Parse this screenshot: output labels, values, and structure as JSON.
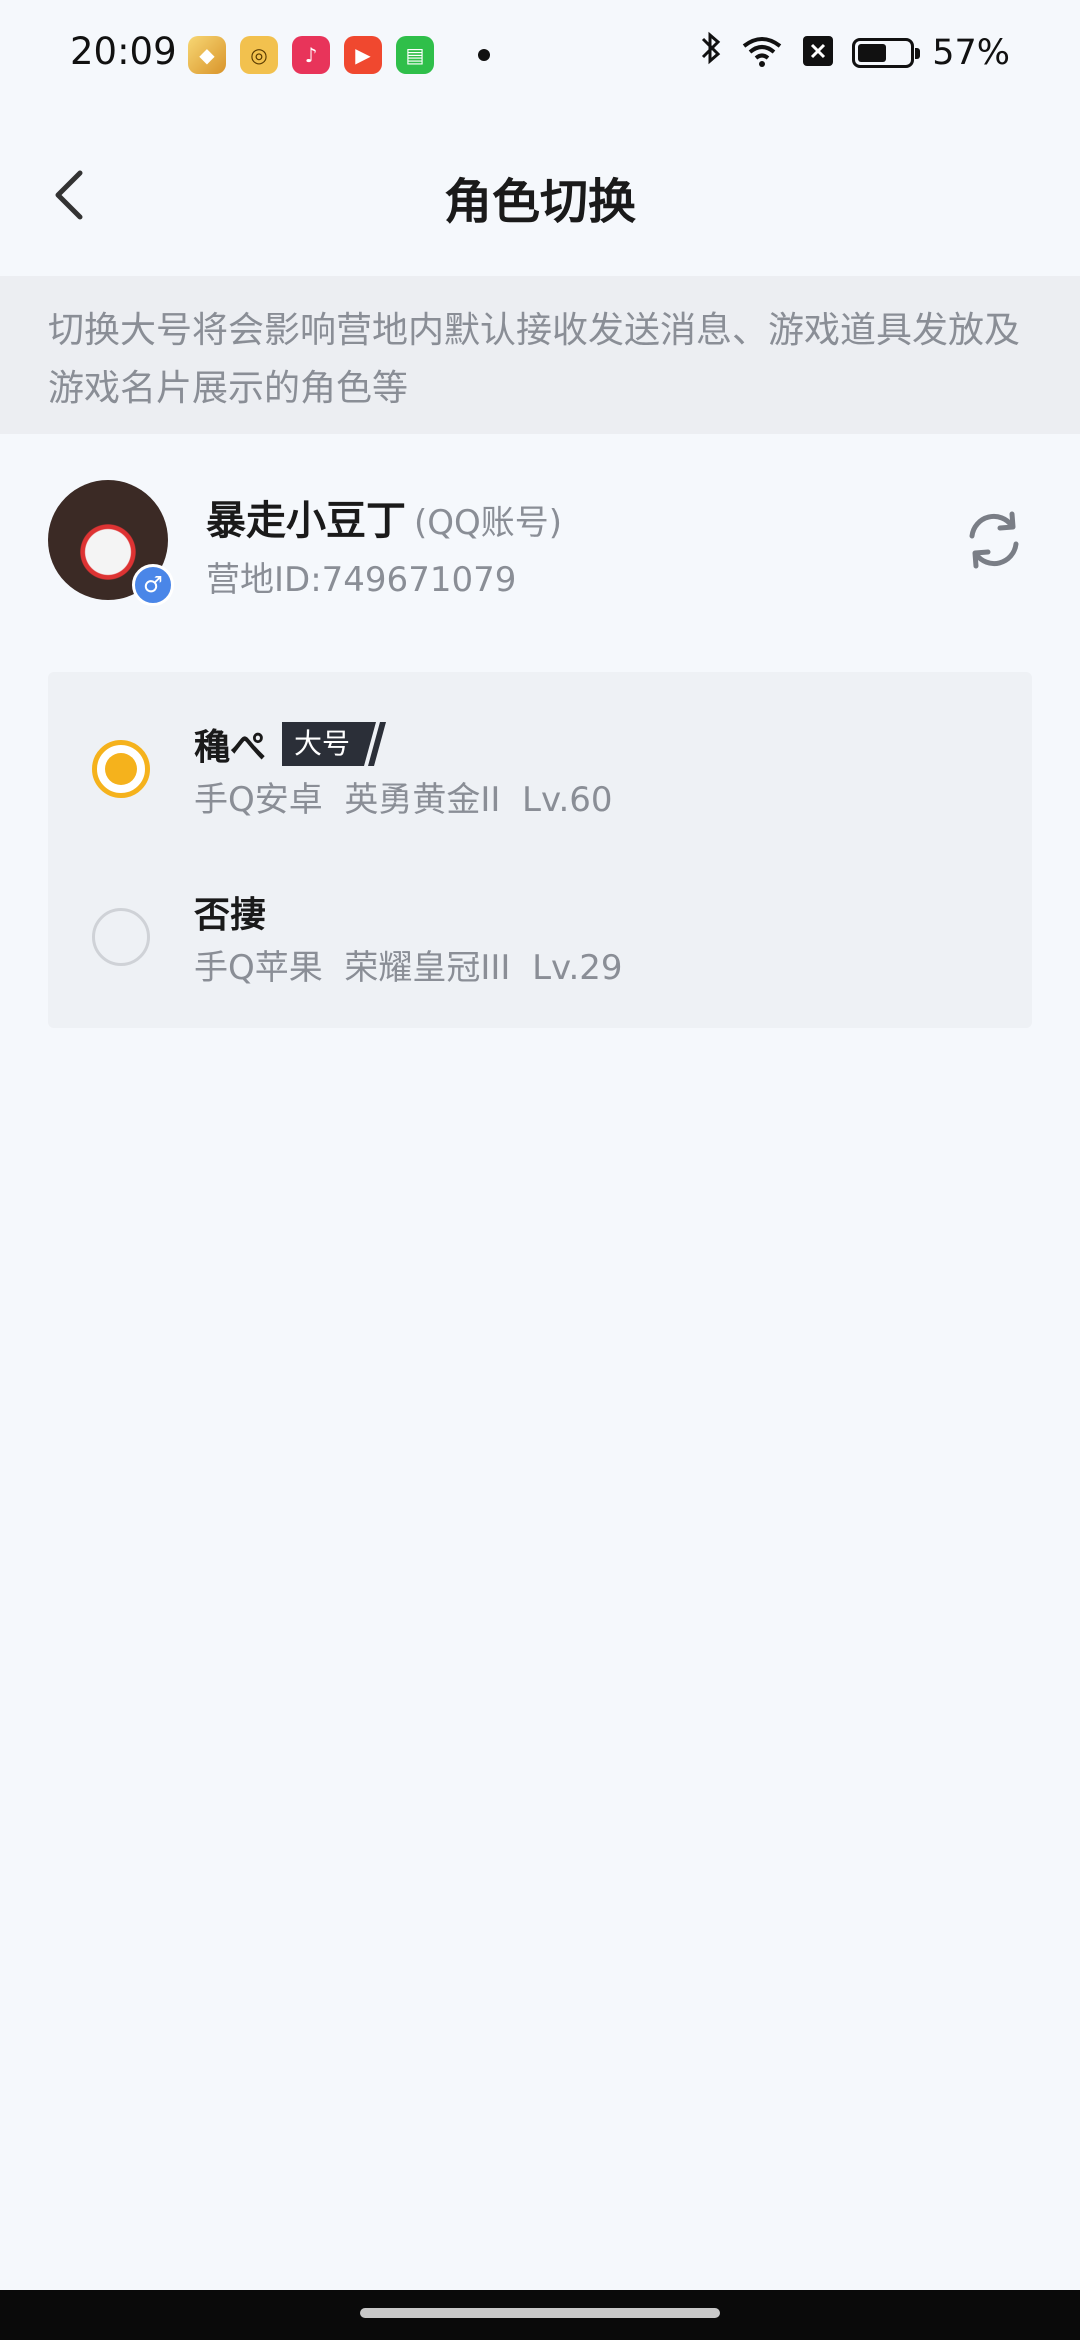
{
  "status_bar": {
    "time": "20:09",
    "battery_percent": "57%",
    "battery_level": 0.57,
    "notification_icons": [
      "game-app-icon",
      "headset-app-icon",
      "music-app-icon",
      "video-app-icon",
      "message-app-icon"
    ],
    "status_icons": [
      "bluetooth-icon",
      "wifi-icon",
      "sim-off-icon",
      "battery-icon"
    ]
  },
  "header": {
    "title": "角色切换"
  },
  "notice": {
    "text": "切换大号将会影响营地内默认接收发送消息、游戏道具发放及游戏名片展示的角色等"
  },
  "account": {
    "name": "暴走小豆丁",
    "type": "(QQ账号)",
    "id_text": "营地ID:749671079",
    "gender": "male"
  },
  "roles": [
    {
      "name": "穐ぺ",
      "badge": "大号",
      "info": "手Q安卓  英勇黄金II  Lv.60",
      "selected": true
    },
    {
      "name": "否捿",
      "badge": "",
      "info": "手Q苹果  荣耀皇冠III  Lv.29",
      "selected": false
    }
  ],
  "colors": {
    "accent": "#f5b21c",
    "background": "#f5f8fc",
    "notice_bg": "#eceef2",
    "secondary_text": "#8a8e96",
    "badge_bg": "#2b2f38",
    "gender_badge": "#4a86e8"
  }
}
